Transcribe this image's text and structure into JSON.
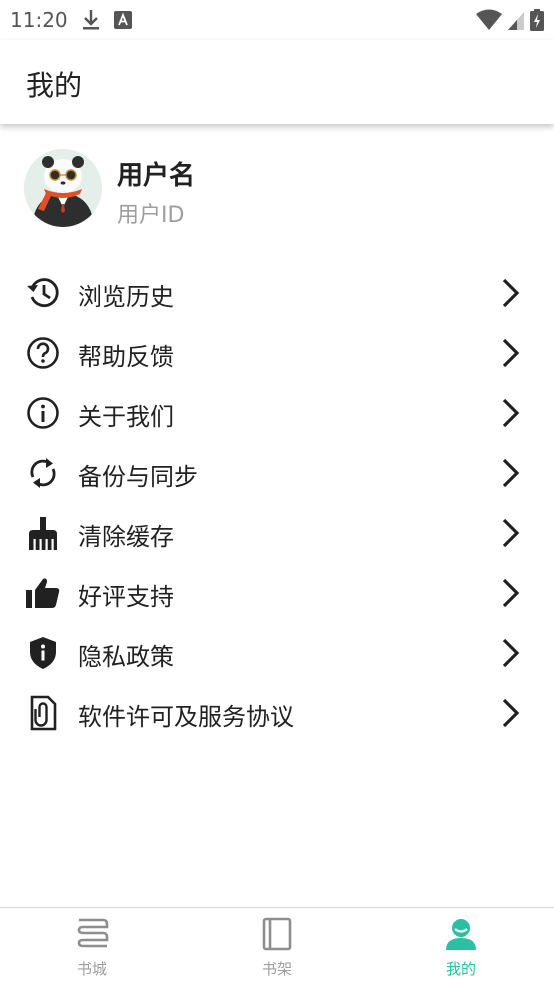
{
  "status_bar": {
    "time": "11:20",
    "icons": [
      "download-icon",
      "a-notification-icon",
      "wifi-icon",
      "signal-icon",
      "battery-charging-icon"
    ]
  },
  "app_bar": {
    "title": "我的"
  },
  "profile": {
    "username": "用户名",
    "user_id": "用户ID",
    "avatar": "panda-avatar"
  },
  "menu": {
    "items": [
      {
        "label": "浏览历史",
        "icon": "history-icon"
      },
      {
        "label": "帮助反馈",
        "icon": "help-icon"
      },
      {
        "label": "关于我们",
        "icon": "info-icon"
      },
      {
        "label": "备份与同步",
        "icon": "sync-icon"
      },
      {
        "label": "清除缓存",
        "icon": "broom-icon"
      },
      {
        "label": "好评支持",
        "icon": "thumbs-up-icon"
      },
      {
        "label": "隐私政策",
        "icon": "shield-icon"
      },
      {
        "label": "软件许可及服务协议",
        "icon": "document-clip-icon"
      }
    ]
  },
  "bottom_nav": {
    "items": [
      {
        "label": "书城",
        "icon": "book-store-icon",
        "active": false
      },
      {
        "label": "书架",
        "icon": "bookshelf-icon",
        "active": false
      },
      {
        "label": "我的",
        "icon": "profile-icon",
        "active": true
      }
    ]
  },
  "colors": {
    "accent": "#2bbfa4",
    "text": "#212121",
    "secondary": "#9e9e9e",
    "icon": "#212121"
  }
}
